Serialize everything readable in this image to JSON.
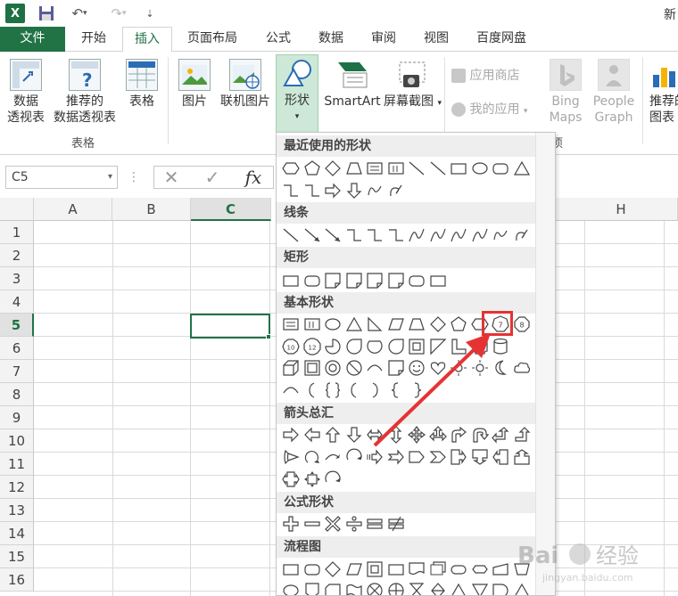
{
  "titlebar": {
    "title_fragment": "新"
  },
  "tabs": [
    "文件",
    "开始",
    "插入",
    "页面布局",
    "公式",
    "数据",
    "审阅",
    "视图",
    "百度网盘"
  ],
  "ribbon": {
    "tables": {
      "pivot_l1": "数据",
      "pivot_l2": "透视表",
      "rec_l1": "推荐的",
      "rec_l2": "数据透视表",
      "table": "表格",
      "group": "表格"
    },
    "illustrations": {
      "picture": "图片",
      "online_picture": "联机图片",
      "shapes": "形状",
      "smartart": "SmartArt",
      "screenshot": "屏幕截图"
    },
    "apps": {
      "store": "应用商店",
      "my_apps": "我的应用",
      "group_tail": "项"
    },
    "bing": {
      "l1": "Bing",
      "l2": "Maps"
    },
    "people": {
      "l1": "People",
      "l2": "Graph"
    },
    "charts": {
      "l1": "推荐的",
      "l2": "图表"
    }
  },
  "formula": {
    "namebox": "C5",
    "cancel": "✕",
    "enter": "✓",
    "fx": "fx"
  },
  "grid": {
    "columns": [
      "A",
      "B",
      "C",
      "H"
    ],
    "rows": [
      "1",
      "2",
      "3",
      "4",
      "5",
      "6",
      "7",
      "8",
      "9",
      "10",
      "11",
      "12",
      "13",
      "14",
      "15",
      "16"
    ],
    "active_cell": "C5"
  },
  "shapes_menu": {
    "sections": [
      "最近使用的形状",
      "线条",
      "矩形",
      "基本形状",
      "箭头总汇",
      "公式形状",
      "流程图"
    ],
    "octagon_7_label": "7",
    "octagon_8_label": "8",
    "dec_10_label": "10",
    "dodec_12_label": "12"
  },
  "colors": {
    "excel_green": "#217346",
    "highlight_red": "#e53333"
  }
}
